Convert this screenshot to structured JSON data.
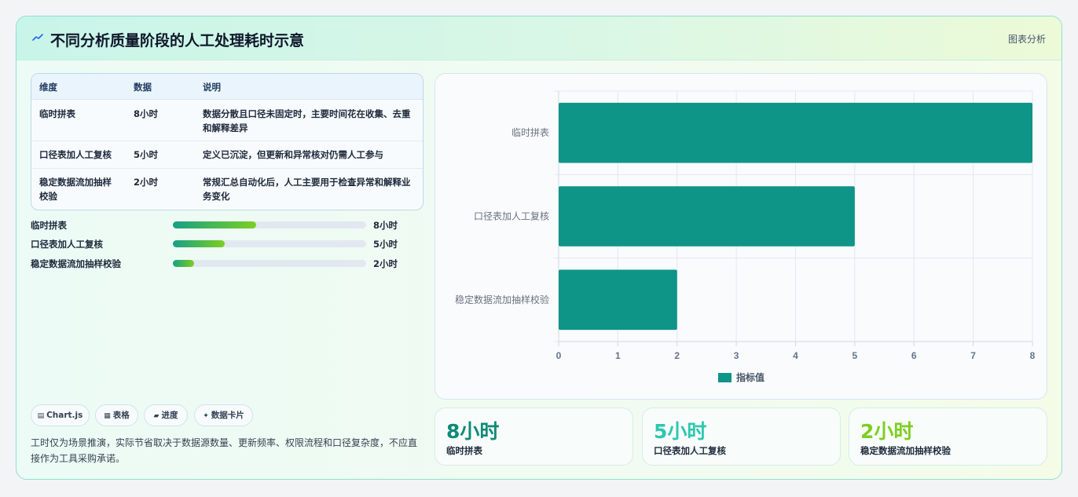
{
  "header": {
    "title": "不同分析质量阶段的人工处理耗时示意",
    "tag": "图表分析"
  },
  "table": {
    "columns": [
      "维度",
      "数据",
      "说明"
    ],
    "rows": [
      {
        "dim": "临时拼表",
        "data": "8小时",
        "desc": "数据分散且口径未固定时，主要时间花在收集、去重和解释差异"
      },
      {
        "dim": "口径表加人工复核",
        "data": "5小时",
        "desc": "定义已沉淀，但更新和异常核对仍需人工参与"
      },
      {
        "dim": "稳定数据流加抽样校验",
        "data": "2小时",
        "desc": "常规汇总自动化后，人工主要用于检查异常和解释业务变化"
      }
    ]
  },
  "progress": [
    {
      "label": "临时拼表",
      "value": "8小时",
      "fraction": 0.43
    },
    {
      "label": "口径表加人工复核",
      "value": "5小时",
      "fraction": 0.27
    },
    {
      "label": "稳定数据流加抽样校验",
      "value": "2小时",
      "fraction": 0.11
    }
  ],
  "chips": [
    {
      "icon": "▤",
      "label": "Chart.js"
    },
    {
      "icon": "▦",
      "label": "表格"
    },
    {
      "icon": "▰",
      "label": "进度"
    },
    {
      "icon": "✦",
      "label": "数据卡片"
    }
  ],
  "note": "工时仅为场景推演，实际节省取决于数据源数量、更新频率、权限流程和口径复杂度，不应直接作为工具采购承诺。",
  "stats": [
    {
      "value": "8小时",
      "label": "临时拼表",
      "color": "#0f8a78"
    },
    {
      "value": "5小时",
      "label": "口径表加人工复核",
      "color": "#2ec7b0"
    },
    {
      "value": "2小时",
      "label": "稳定数据流加抽样校验",
      "color": "#7ccf21"
    }
  ],
  "chart_data": {
    "type": "bar",
    "orientation": "horizontal",
    "categories": [
      "临时拼表",
      "口径表加人工复核",
      "稳定数据流加抽样校验"
    ],
    "series": [
      {
        "name": "指标值",
        "values": [
          8,
          5,
          2
        ]
      }
    ],
    "xlim": [
      0,
      8
    ],
    "xticks": [
      0,
      1,
      2,
      3,
      4,
      5,
      6,
      7,
      8
    ],
    "grid": true,
    "legend": "bottom",
    "bar_color": "#0f9488"
  }
}
